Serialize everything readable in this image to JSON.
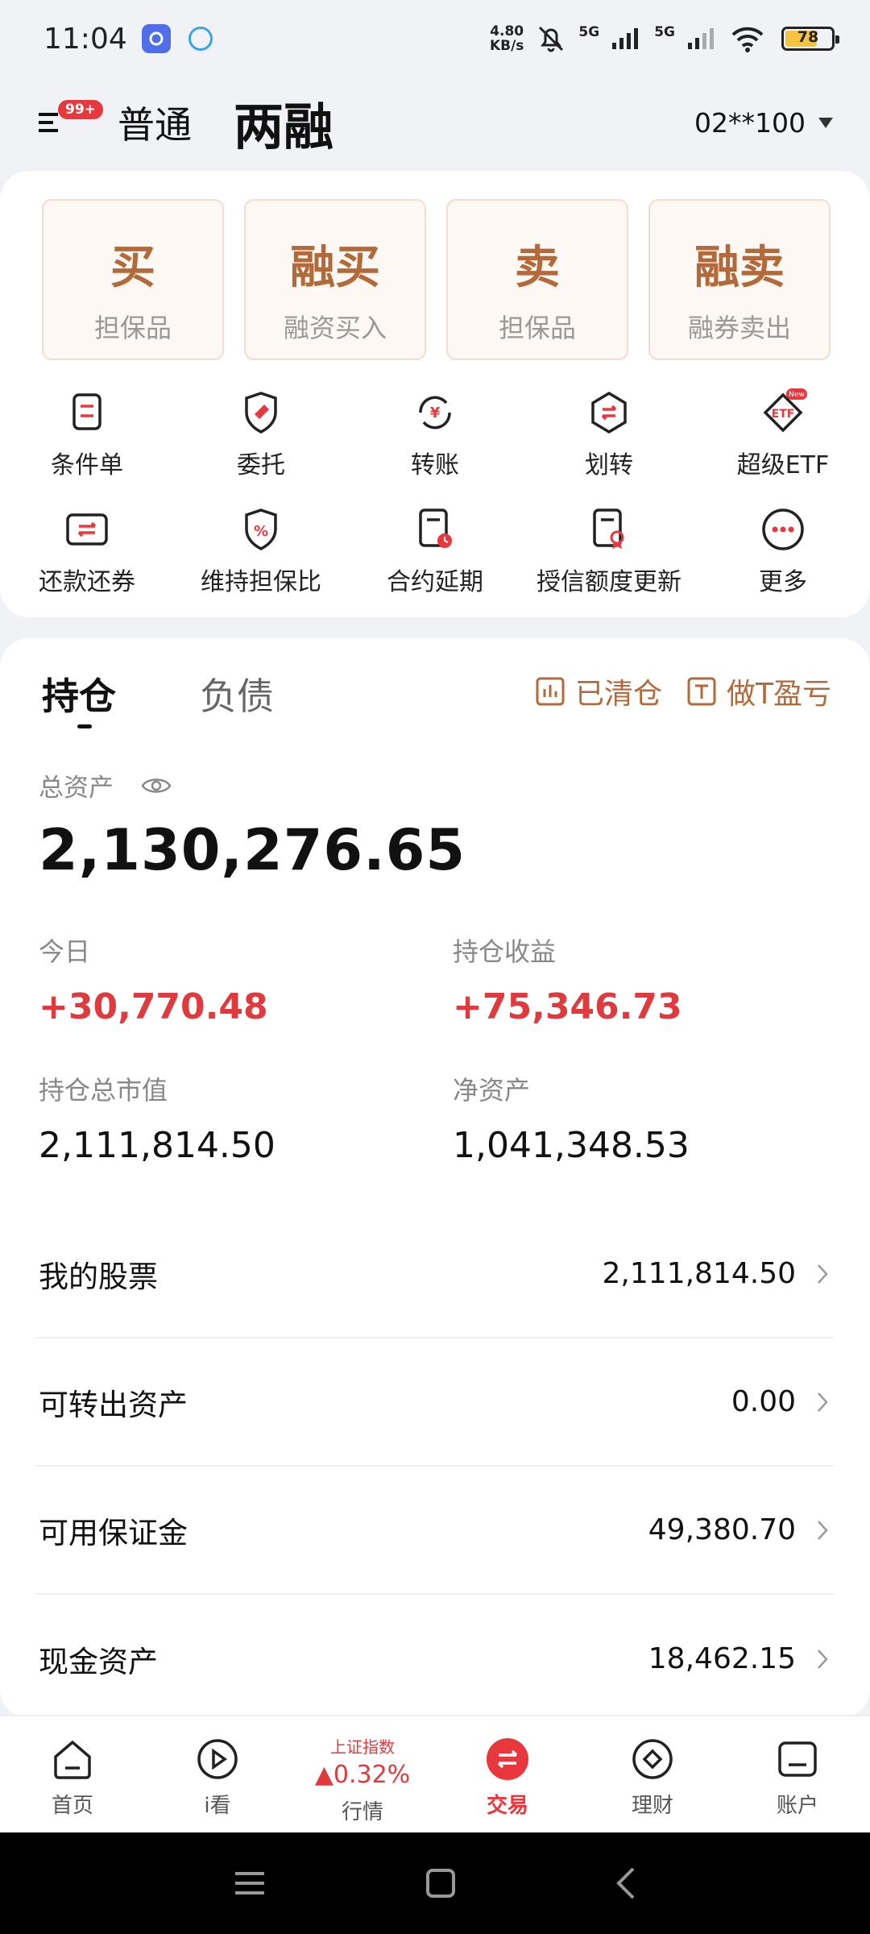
{
  "status_bar": {
    "time": "11:04",
    "net_speed_value": "4.80",
    "net_speed_unit": "KB/s",
    "signal1_label": "5G",
    "signal2_label": "5G",
    "battery": "78"
  },
  "header": {
    "menu_badge": "99+",
    "mode_tabs": [
      "普通",
      "两融"
    ],
    "account": "02**100"
  },
  "trade_buttons": [
    {
      "main": "买",
      "sub": "担保品"
    },
    {
      "main": "融买",
      "sub": "融资买入"
    },
    {
      "main": "卖",
      "sub": "担保品"
    },
    {
      "main": "融卖",
      "sub": "融券卖出"
    }
  ],
  "functions": [
    {
      "label": "条件单",
      "icon": "condition-order-icon"
    },
    {
      "label": "委托",
      "icon": "entrust-icon"
    },
    {
      "label": "转账",
      "icon": "transfer-icon"
    },
    {
      "label": "划转",
      "icon": "swap-transfer-icon"
    },
    {
      "label": "超级ETF",
      "icon": "etf-icon",
      "badge": "New"
    },
    {
      "label": "还款还券",
      "icon": "repay-icon"
    },
    {
      "label": "维持担保比",
      "icon": "guarantee-ratio-icon"
    },
    {
      "label": "合约延期",
      "icon": "contract-extension-icon"
    },
    {
      "label": "授信额度更新",
      "icon": "credit-limit-icon"
    },
    {
      "label": "更多",
      "icon": "more-icon"
    }
  ],
  "main": {
    "tabs": [
      "持仓",
      "负债"
    ],
    "tools": [
      "已清仓",
      "做T盈亏"
    ],
    "total_assets_label": "总资产",
    "total_assets": "2,130,276.65",
    "stats": [
      {
        "label": "今日",
        "value": "+30,770.48"
      },
      {
        "label": "持仓收益",
        "value": "+75,346.73"
      },
      {
        "label": "持仓总市值",
        "value": "2,111,814.50"
      },
      {
        "label": "净资产",
        "value": "1,041,348.53"
      }
    ],
    "list": [
      {
        "label": "我的股票",
        "value": "2,111,814.50"
      },
      {
        "label": "可转出资产",
        "value": "0.00"
      },
      {
        "label": "可用保证金",
        "value": "49,380.70"
      },
      {
        "label": "现金资产",
        "value": "18,462.15"
      }
    ]
  },
  "bottom_nav": {
    "items": [
      "首页",
      "i看",
      "行情",
      "交易",
      "理财",
      "账户"
    ],
    "index_name": "上证指数",
    "index_change": "▲0.32%"
  },
  "colors": {
    "accent_brown": "#b36a3a",
    "up_red": "#e03a3e",
    "brand_red": "#e8383d"
  }
}
